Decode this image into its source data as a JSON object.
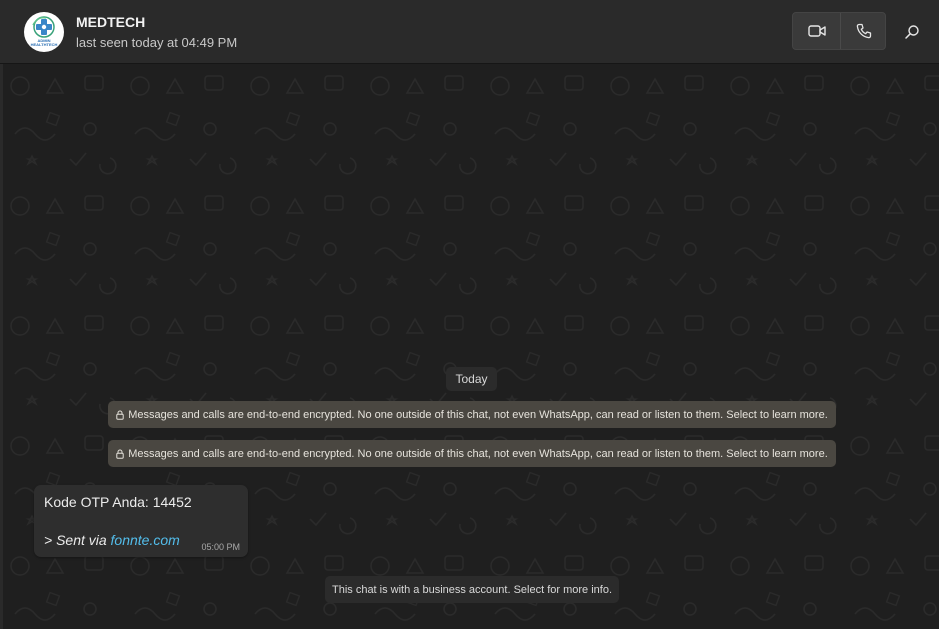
{
  "header": {
    "contact_name": "MEDTECH",
    "status": "last seen today at 04:49 PM",
    "avatar": {
      "line1": "ADMIN",
      "line2": "HEALTHTECH",
      "icon": "medical-cross-logo-icon"
    },
    "video_call_icon": "video-camera-icon",
    "voice_call_icon": "phone-icon",
    "search_icon": "search-icon"
  },
  "chat": {
    "date_chip": "Today",
    "system_messages": [
      "Messages and calls are end-to-end encrypted. No one outside of this chat, not even WhatsApp, can read or listen to them. Select to learn more.",
      "Messages and calls are end-to-end encrypted. No one outside of this chat, not even WhatsApp, can read or listen to them. Select to learn more."
    ],
    "message": {
      "text": "Kode OTP Anda: 14452",
      "footer_prefix": "> Sent via ",
      "footer_link": "fonnte.com",
      "time": "05:00 PM"
    },
    "business_notice": "This chat is with a business account. Select for more info."
  },
  "colors": {
    "header_bg": "#2a2a2a",
    "chat_bg": "#1f1f1f",
    "bubble_bg": "#2e2e2e",
    "system_msg_bg": "#4a4741",
    "link": "#53bdeb"
  }
}
